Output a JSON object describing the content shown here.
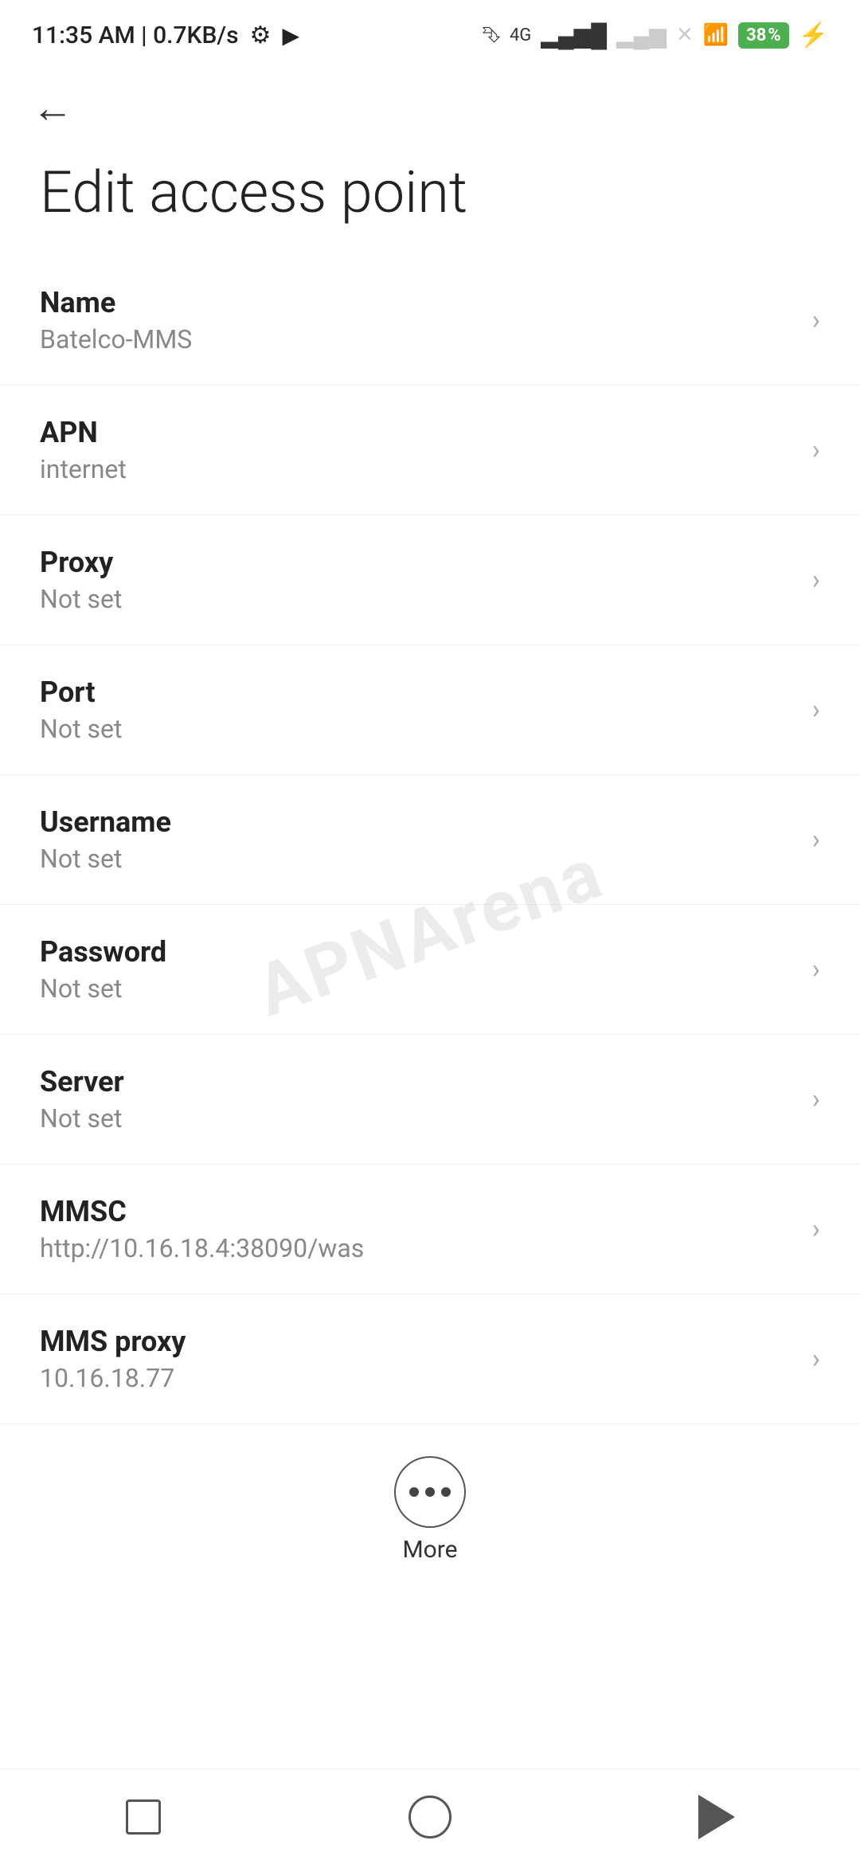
{
  "statusBar": {
    "time": "11:35 AM | 0.7KB/s",
    "battery": "38"
  },
  "header": {
    "back_label": "←",
    "title": "Edit access point"
  },
  "settings": {
    "items": [
      {
        "label": "Name",
        "value": "Batelco-MMS"
      },
      {
        "label": "APN",
        "value": "internet"
      },
      {
        "label": "Proxy",
        "value": "Not set"
      },
      {
        "label": "Port",
        "value": "Not set"
      },
      {
        "label": "Username",
        "value": "Not set"
      },
      {
        "label": "Password",
        "value": "Not set"
      },
      {
        "label": "Server",
        "value": "Not set"
      },
      {
        "label": "MMSC",
        "value": "http://10.16.18.4:38090/was"
      },
      {
        "label": "MMS proxy",
        "value": "10.16.18.77"
      }
    ]
  },
  "more": {
    "label": "More"
  },
  "watermark": "APNArena",
  "navBar": {
    "square_label": "recent-apps",
    "circle_label": "home",
    "triangle_label": "back"
  }
}
